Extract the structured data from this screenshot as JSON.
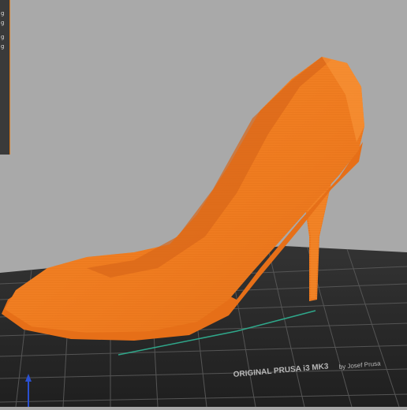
{
  "app": {
    "view": "3D preview"
  },
  "side_panel": {
    "marks": [
      "g",
      "g",
      "g",
      "g"
    ]
  },
  "bed": {
    "brand_text": "ORIGINAL PRUSA i3  MK3",
    "byline_text": "by Josef Prusa"
  },
  "colors": {
    "background": "#a9a9a9",
    "bed_dark": "#2a2a2a",
    "grid_line": "#555555",
    "model_orange": "#f07d22",
    "model_shadow": "#c85a10",
    "axis_x": "#c03030",
    "axis_y": "#30a040",
    "axis_z": "#2a50d0",
    "panel_accent": "#e07b1a"
  },
  "icons": [
    "axis-gizmo"
  ]
}
